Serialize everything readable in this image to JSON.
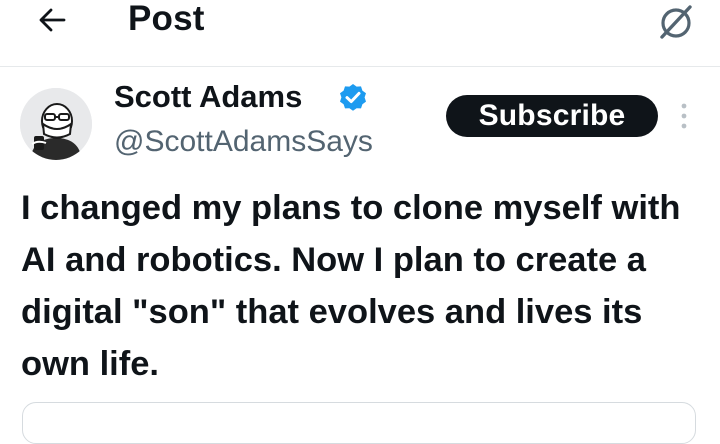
{
  "header": {
    "title": "Post",
    "back_icon": "arrow-left-icon",
    "grok_icon": "grok-icon"
  },
  "author": {
    "name": "Scott Adams",
    "handle": "@ScottAdamsSays",
    "verified": true,
    "verified_color": "#1d9bf0",
    "avatar_icon": "avatar-illustration"
  },
  "actions": {
    "subscribe_label": "Subscribe",
    "more_icon": "more-vertical-icon"
  },
  "post": {
    "text": "I changed my plans to clone myself with AI and robotics. Now I plan to create a digital \"son\" that evolves and lives its own life."
  },
  "colors": {
    "text": "#0f1419",
    "secondary": "#536471",
    "button_bg": "#0f1419",
    "button_text": "#ffffff",
    "divider": "#e6e9eb"
  }
}
